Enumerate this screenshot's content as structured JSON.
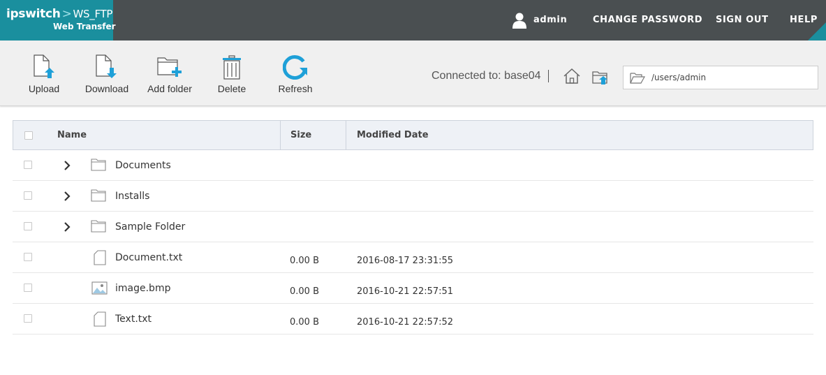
{
  "header": {
    "logo_brand": "ipswitch",
    "logo_separator": ">",
    "logo_product": "WS_FTP",
    "logo_subtitle": "Web Transfer",
    "username": "admin",
    "change_password": "CHANGE PASSWORD",
    "sign_out": "SIGN OUT",
    "help": "HELP"
  },
  "toolbar": {
    "upload": "Upload",
    "download": "Download",
    "add_folder": "Add folder",
    "delete": "Delete",
    "refresh": "Refresh",
    "connected_text": "Connected to: base04",
    "path": "/users/admin"
  },
  "table": {
    "columns": {
      "name": "Name",
      "size": "Size",
      "modified": "Modified Date"
    },
    "rows": [
      {
        "type": "folder",
        "name": "Documents",
        "size": "",
        "modified": ""
      },
      {
        "type": "folder",
        "name": "Installs",
        "size": "",
        "modified": ""
      },
      {
        "type": "folder",
        "name": "Sample Folder",
        "size": "",
        "modified": ""
      },
      {
        "type": "file",
        "name": "Document.txt",
        "size": "0.00 B",
        "modified": "2016-08-17 23:31:55"
      },
      {
        "type": "image",
        "name": "image.bmp",
        "size": "0.00 B",
        "modified": "2016-10-21 22:57:51"
      },
      {
        "type": "file",
        "name": "Text.txt",
        "size": "0.00 B",
        "modified": "2016-10-21 22:57:52"
      }
    ]
  },
  "colors": {
    "topbar": "#4a4f51",
    "brand_teal": "#1a8f9e",
    "accent_blue": "#1ea0d8",
    "toolbar_bg": "#f0f0f0",
    "table_header_bg": "#eef1f6"
  },
  "icons": {
    "user": "user-icon",
    "upload": "upload-icon",
    "download": "download-icon",
    "add_folder": "add-folder-icon",
    "delete": "trash-icon",
    "refresh": "refresh-icon",
    "home": "home-icon",
    "parent_folder": "folder-up-icon",
    "path_folder": "open-folder-icon",
    "expand": "chevron-right-icon",
    "folder": "folder-icon",
    "file": "file-icon",
    "image": "image-file-icon"
  }
}
